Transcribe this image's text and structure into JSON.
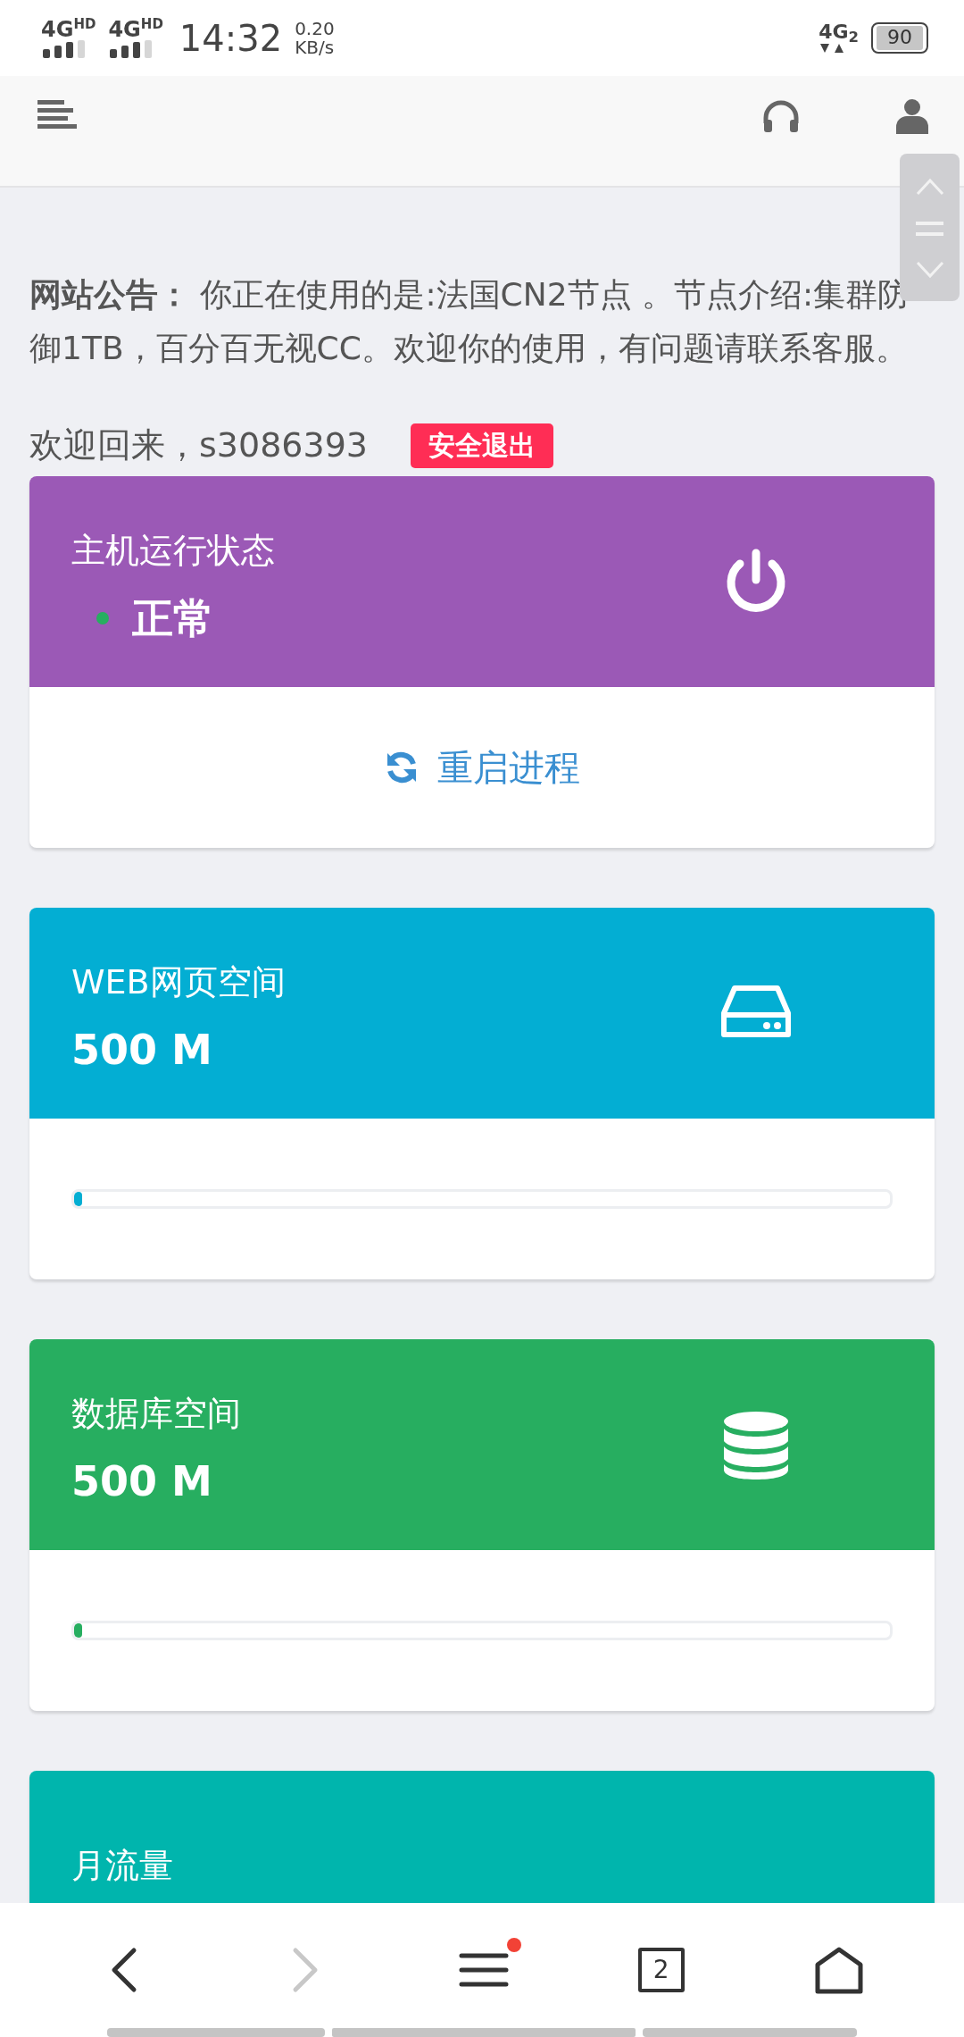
{
  "status_bar": {
    "sims": [
      "4G$^{HD}$",
      "4G$^{HD}$"
    ],
    "time": "14:32",
    "speed": "0.20",
    "speed_unit": "KB/s",
    "network": "4G$_{2}$",
    "battery": "90"
  },
  "announcement": "**网站公告：** 你正在使用的是:法国CN2节点 。节点介绍:集群防御1TB，百分百无视CC。欢迎你的使用，有问题请联系客服。",
  "welcome": {
    "text": "欢迎回来，s3086393",
    "logout": "安全退出"
  },
  "cards": [
    {
      "kind": "status",
      "title": "主机运行状态",
      "value": "正常",
      "color": "#9b59b6",
      "status_dot": {
        "color": "#27ae60"
      },
      "action": "重启进程"
    },
    {
      "kind": "web",
      "title": "WEB网页空间",
      "value": "500 M",
      "color": "#03aed3",
      "level": 0.01
    },
    {
      "kind": "database",
      "title": "数据库空间",
      "value": "500 M",
      "color": "#27ae60",
      "level": 0.01
    },
    {
      "kind": "traffic",
      "title": "月流量",
      "color": "#00b5ad"
    }
  ],
  "bottom_nav": [
    {
      "kind": "back",
      "disabled": false
    },
    {
      "kind": "forward",
      "disabled": true
    },
    {
      "kind": "menu",
      "disabled": false,
      "badge": true
    },
    {
      "kind": "tabs",
      "disabled": false,
      "count": "2"
    },
    {
      "kind": "home",
      "disabled": false
    }
  ]
}
